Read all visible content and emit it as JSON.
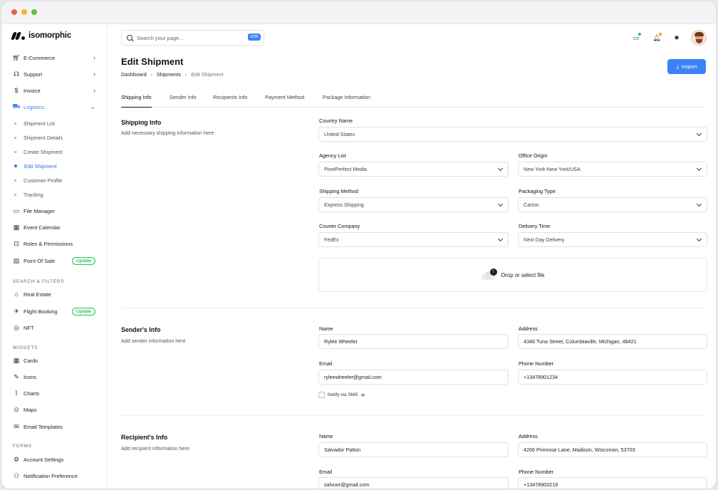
{
  "window": {
    "controls": [
      "close",
      "minimize",
      "maximize"
    ]
  },
  "brand": {
    "name": "isomorphic"
  },
  "sidebar": {
    "items": [
      {
        "label": "E-Commerce",
        "icon": "cart-icon",
        "has_chevron": true
      },
      {
        "label": "Support",
        "icon": "headset-icon",
        "has_chevron": true
      },
      {
        "label": "Invoice",
        "icon": "dollar-icon",
        "has_chevron": true
      },
      {
        "label": "Logistics",
        "icon": "truck-icon",
        "has_chevron": true,
        "expanded": true
      }
    ],
    "logistics_sub": [
      "Shipment List",
      "Shipment Details",
      "Create Shipment",
      "Edit Shipment",
      "Customer Profile",
      "Tracking"
    ],
    "more_items": [
      {
        "label": "File Manager",
        "icon": "folder-icon"
      },
      {
        "label": "Event Calendar",
        "icon": "calendar-icon"
      },
      {
        "label": "Roles & Permissions",
        "icon": "lock-icon"
      },
      {
        "label": "Point Of Sale",
        "icon": "pos-icon",
        "badge": "Update"
      }
    ],
    "search_filters_title": "SEARCH & FILTERS",
    "search_filters": [
      {
        "label": "Real Estate",
        "icon": "building-icon"
      },
      {
        "label": "Flight Booking",
        "icon": "plane-icon",
        "badge": "Update"
      },
      {
        "label": "NFT",
        "icon": "nft-icon"
      }
    ],
    "widgets_title": "WIDGETS",
    "widgets": [
      {
        "label": "Cards",
        "icon": "cards-icon"
      },
      {
        "label": "Icons",
        "icon": "brush-icon"
      },
      {
        "label": "Charts",
        "icon": "chart-icon"
      },
      {
        "label": "Maps",
        "icon": "map-pin-icon"
      },
      {
        "label": "Email Templates",
        "icon": "mail-icon"
      }
    ],
    "forms_title": "FORMS",
    "forms": [
      {
        "label": "Account Settings",
        "icon": "user-gear-icon"
      },
      {
        "label": "Notification Preference",
        "icon": "bell-settings-icon"
      }
    ]
  },
  "header": {
    "search_placeholder": "Search your page...",
    "search_shortcut": "ctrlK"
  },
  "page": {
    "title": "Edit Shipment",
    "breadcrumbs": [
      "Dashboard",
      "Shipments",
      "Edit Shipment"
    ],
    "import_label": "Import",
    "tabs": [
      "Shipping Info",
      "Sender Info",
      "Recipients Info",
      "Payment Method",
      "Package Information"
    ],
    "active_tab": "Shipping Info"
  },
  "shipping": {
    "title": "Shipping Info",
    "desc": "Add necessary shipping information here",
    "country_label": "Country Name",
    "country": "United States",
    "agency_label": "Agency List",
    "agency": "PixelPerfect Media",
    "office_label": "Office Origin",
    "office": "New York-New York/USA",
    "method_label": "Shipping Method",
    "method": "Express Shipping",
    "packaging_label": "Packaging Type",
    "packaging": "Carton",
    "courier_label": "Courier Company",
    "courier": "FedEx",
    "delivery_label": "Delivery Time",
    "delivery": "Next Day Delivery",
    "dropzone": "Drop or select file"
  },
  "sender": {
    "title": "Sender's Info",
    "desc": "Add sender information here",
    "name_label": "Name",
    "name": "Rylee Wheeler",
    "address_label": "Address",
    "address": "4348 Tuna Street, Columbiaville, Michigan, 48421",
    "email_label": "Email",
    "email": "ryleewheeler@gmail.com",
    "phone_label": "Phone Number",
    "phone": "+13478901234",
    "notify_label": "Notify via SMS"
  },
  "recipient": {
    "title": "Recipient's Info",
    "desc": "Add recipient information here",
    "name_label": "Name",
    "name": "Salvador Patton",
    "address_label": "Address",
    "address": "4266 Primrose Lane, Madison, Wisconsin, 53703",
    "email_label": "Email",
    "email": "salvoor@gmail.com",
    "phone_label": "Phone Number",
    "phone": "+13478903219"
  },
  "colors": {
    "accent": "#3b82f6",
    "badge_green": "#22c55e"
  }
}
